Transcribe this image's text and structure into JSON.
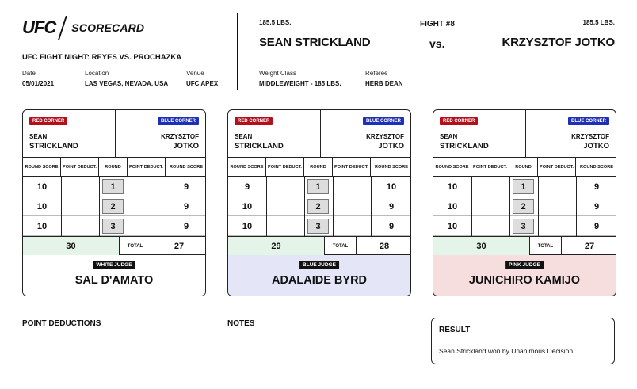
{
  "brand": {
    "logo": "UFC",
    "title": "SCORECARD"
  },
  "event": {
    "name": "UFC FIGHT NIGHT: REYES VS. PROCHAZKA",
    "date_label": "Date",
    "date": "05/01/2021",
    "location_label": "Location",
    "location": "LAS VEGAS, NEVADA, USA",
    "venue_label": "Venue",
    "venue": "UFC APEX"
  },
  "fight": {
    "number": "FIGHT #8",
    "vs": "vs.",
    "red_weight": "185.5 LBS.",
    "red_name": "SEAN STRICKLAND",
    "blue_weight": "185.5 LBS.",
    "blue_name": "KRZYSZTOF JOTKO",
    "weight_class_label": "Weight Class",
    "weight_class": "MIDDLEWEIGHT - 185 LBS.",
    "referee_label": "Referee",
    "referee": "HERB DEAN"
  },
  "card_labels": {
    "red_corner": "RED CORNER",
    "blue_corner": "BLUE CORNER",
    "red_first": "SEAN",
    "red_last": "STRICKLAND",
    "blue_first": "KRZYSZTOF",
    "blue_last": "JOTKO",
    "round_score": "ROUND SCORE",
    "point_deduct": "POINT DEDUCT.",
    "round": "ROUND",
    "total": "TOTAL"
  },
  "judges": [
    {
      "tag": "WHITE JUDGE",
      "name": "SAL D'AMATO",
      "color": "white",
      "rounds": [
        {
          "round": "1",
          "red": "10",
          "blue": "9"
        },
        {
          "round": "2",
          "red": "10",
          "blue": "9"
        },
        {
          "round": "3",
          "red": "10",
          "blue": "9"
        }
      ],
      "red_total": "30",
      "blue_total": "27"
    },
    {
      "tag": "BLUE JUDGE",
      "name": "ADALAIDE BYRD",
      "color": "blue",
      "rounds": [
        {
          "round": "1",
          "red": "9",
          "blue": "10"
        },
        {
          "round": "2",
          "red": "10",
          "blue": "9"
        },
        {
          "round": "3",
          "red": "10",
          "blue": "9"
        }
      ],
      "red_total": "29",
      "blue_total": "28"
    },
    {
      "tag": "PINK JUDGE",
      "name": "JUNICHIRO KAMIJO",
      "color": "pink",
      "rounds": [
        {
          "round": "1",
          "red": "10",
          "blue": "9"
        },
        {
          "round": "2",
          "red": "10",
          "blue": "9"
        },
        {
          "round": "3",
          "red": "10",
          "blue": "9"
        }
      ],
      "red_total": "30",
      "blue_total": "27"
    }
  ],
  "sections": {
    "point_deductions": "POINT DEDUCTIONS",
    "notes": "NOTES"
  },
  "result": {
    "title": "RESULT",
    "text": "Sean Strickland won by Unanimous Decision"
  },
  "colors": {
    "red_corner": "#b3101c",
    "blue_corner": "#1e2fb8",
    "winner_total": "#e5f4e8",
    "blue_judge": "#e4e6f8",
    "pink_judge": "#f6dede"
  }
}
